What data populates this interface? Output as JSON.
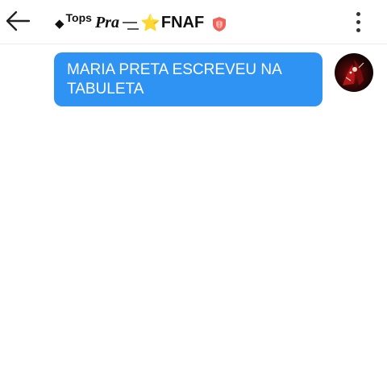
{
  "header": {
    "back_icon": "arrow-left-icon",
    "title": {
      "prefix_symbol": "◆",
      "tops": "Tops",
      "pra": "Pra",
      "star": "⭐",
      "fnaf": "FNAF"
    },
    "badge_icon": "shield-badge-icon",
    "menu_icon": "more-vertical-icon"
  },
  "messages": [
    {
      "text": "MARIA PRETA ESCREVEU NA TABULETA",
      "sender": "me"
    }
  ],
  "colors": {
    "bubble": "#2f93f3",
    "bubble_text": "#ffffff",
    "badge": "#f0615c",
    "star": "#f5b800"
  }
}
